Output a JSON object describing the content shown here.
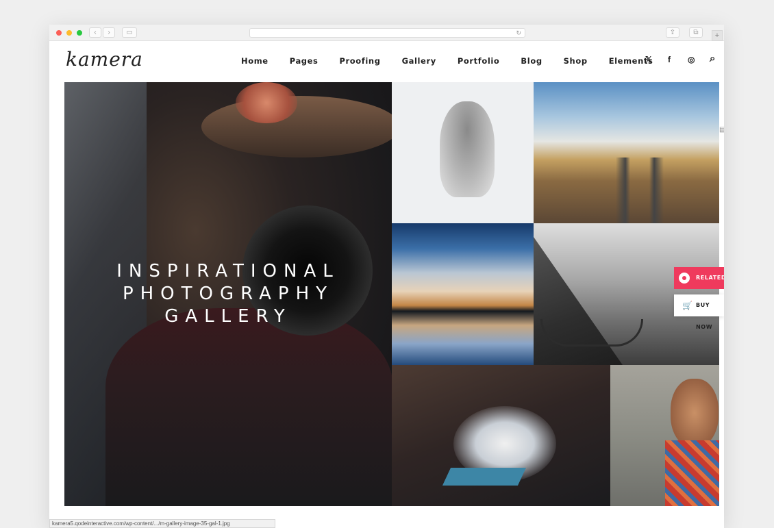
{
  "site": {
    "logo": "kamera"
  },
  "nav": [
    "Home",
    "Pages",
    "Proofing",
    "Gallery",
    "Portfolio",
    "Blog",
    "Shop",
    "Elements"
  ],
  "social": {
    "twitter": "𝕏",
    "facebook": "f",
    "instagram": "◎",
    "search": "⌕"
  },
  "hero": {
    "line1": "INSPIRATIONAL",
    "line2": "PHOTOGRAPHY",
    "line3": "GALLERY"
  },
  "widgets": {
    "related": "RELATED",
    "buy_now": "BUY NOW"
  },
  "status_bar": {
    "url": "kamera5.qodeinteractive.com/wp-content/.../m-gallery-image-35-gal-1.jpg"
  },
  "icons": {
    "twitter": "twitter-icon",
    "facebook": "facebook-icon",
    "instagram": "instagram-icon",
    "search": "search-icon",
    "cart": "cart-icon",
    "related": "related-icon"
  },
  "colors": {
    "accent": "#ef3a5d",
    "text": "#222222"
  }
}
